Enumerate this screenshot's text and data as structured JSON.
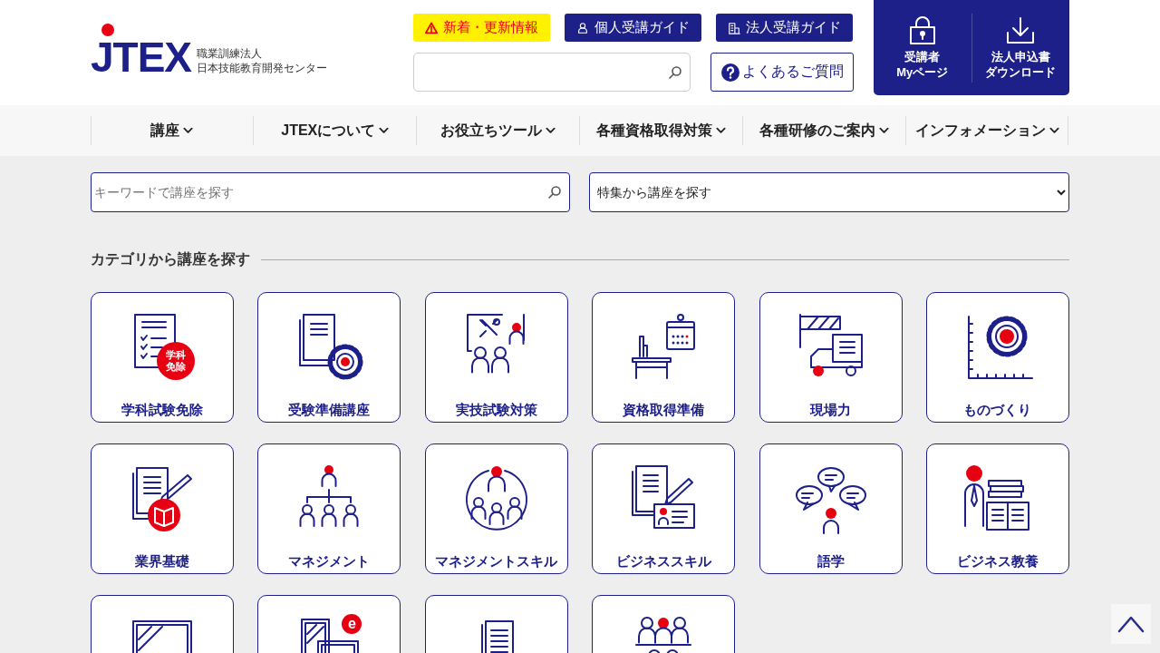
{
  "logo": {
    "mark": "JTEX",
    "subtitle_lines": [
      "職業訓練法人",
      "日本技能教育開発センター"
    ]
  },
  "header_links": [
    {
      "kind": "notice",
      "label": "新着・更新情報"
    },
    {
      "kind": "person",
      "label": "個人受講ガイド"
    },
    {
      "kind": "company",
      "label": "法人受講ガイド"
    }
  ],
  "faq_button": {
    "label": "よくあるご質問"
  },
  "account_links": [
    {
      "kind": "mypage",
      "lines": [
        "受講者",
        "Myページ"
      ]
    },
    {
      "kind": "download",
      "lines": [
        "法人申込書",
        "ダウンロード"
      ]
    }
  ],
  "nav": [
    {
      "label": "講座"
    },
    {
      "label": "JTEXについて"
    },
    {
      "label": "お役立ちツール"
    },
    {
      "label": "各種資格取得対策"
    },
    {
      "label": "各種研修のご案内"
    },
    {
      "label": "インフォメーション"
    }
  ],
  "keyword_search": {
    "placeholder": "キーワードで講座を探す"
  },
  "feature_select": {
    "value": "特集から講座を探す"
  },
  "category_heading": "カテゴリから講座を探す",
  "categories": [
    {
      "kind": "labelled",
      "label": "学科試験免除",
      "badge_lines": [
        "学科",
        "免除"
      ]
    },
    {
      "kind": "labelled",
      "label": "受験準備講座"
    },
    {
      "kind": "labelled",
      "label": "実技試験対策"
    },
    {
      "kind": "labelled",
      "label": "資格取得準備"
    },
    {
      "kind": "labelled",
      "label": "現場力"
    },
    {
      "kind": "labelled",
      "label": "ものづくり"
    },
    {
      "kind": "labelled",
      "label": "業界基礎"
    },
    {
      "kind": "labelled",
      "label": "マネジメント"
    },
    {
      "kind": "labelled",
      "label": "マネジメントスキル"
    },
    {
      "kind": "labelled",
      "label": "ビジネススキル"
    },
    {
      "kind": "labelled",
      "label": "語学"
    },
    {
      "kind": "labelled",
      "label": "ビジネス教養"
    },
    {
      "kind": "cut"
    },
    {
      "kind": "cut",
      "badge_lines": [
        "e"
      ]
    },
    {
      "kind": "cut"
    },
    {
      "kind": "cut"
    }
  ]
}
